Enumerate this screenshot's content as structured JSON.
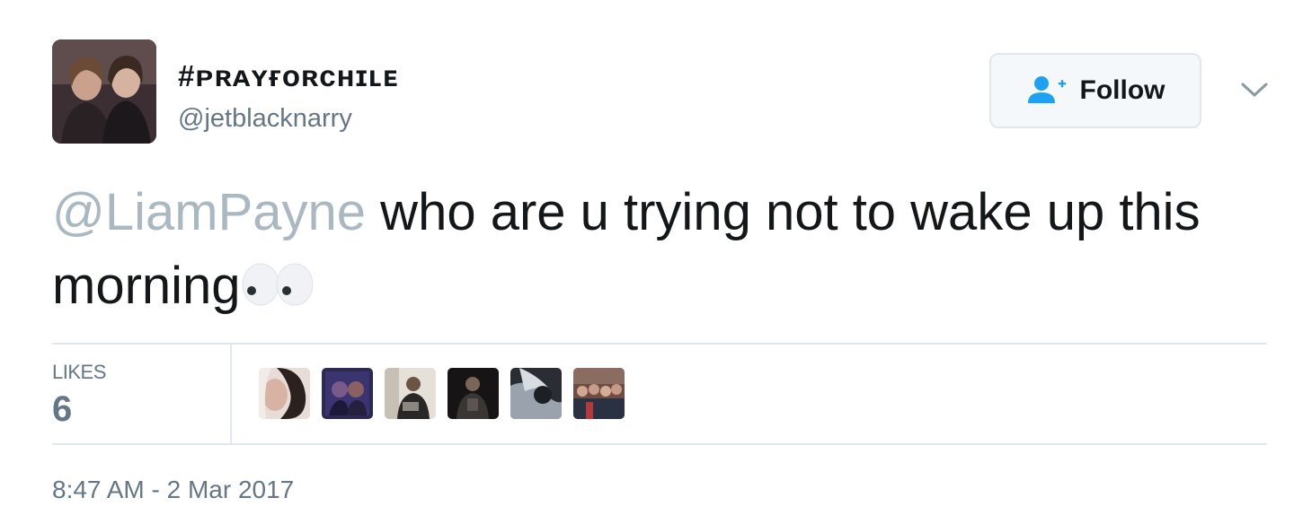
{
  "author": {
    "display_name": "#ᴘʀᴀʏғᴏʀᴄʜɪʟᴇ",
    "handle": "@jetblacknarry",
    "avatar_icon": "profile-photo"
  },
  "follow_button": {
    "label": "Follow",
    "icon": "follow-user-icon",
    "icon_color": "#1da1f2"
  },
  "menu": {
    "icon": "chevron-down-icon"
  },
  "tweet": {
    "mention": "@LiamPayne",
    "text": " who are u trying not to wake up this morning",
    "emoji": "eyes"
  },
  "stats": {
    "likes_label": "LIKES",
    "likes_count": "6"
  },
  "likers": [
    {
      "name": "liker-avatar-1"
    },
    {
      "name": "liker-avatar-2"
    },
    {
      "name": "liker-avatar-3"
    },
    {
      "name": "liker-avatar-4"
    },
    {
      "name": "liker-avatar-5"
    },
    {
      "name": "liker-avatar-6"
    }
  ],
  "timestamp": "8:47 AM - 2 Mar 2017",
  "colors": {
    "mention": "#aab8c2",
    "secondary_text": "#657786",
    "divider": "#e1e8ed"
  }
}
